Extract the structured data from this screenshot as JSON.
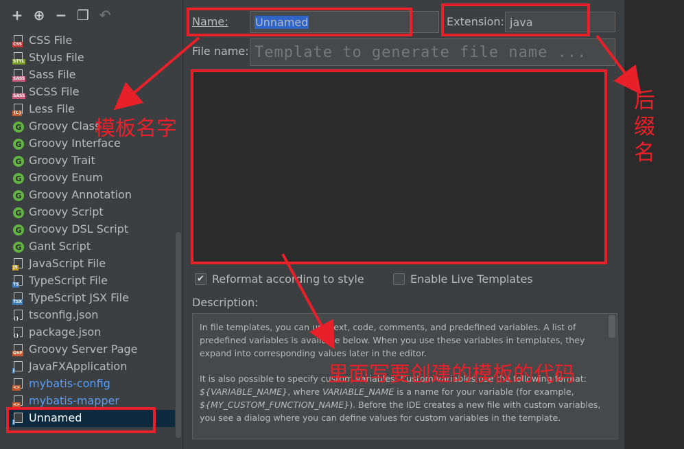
{
  "toolbar": {
    "buttons": [
      {
        "icon": "plus-icon",
        "glyph": "+"
      },
      {
        "icon": "add-child-icon",
        "glyph": "⊕"
      },
      {
        "icon": "minus-icon",
        "glyph": "−"
      },
      {
        "icon": "copy-icon",
        "glyph": "❐"
      },
      {
        "icon": "reset-icon",
        "glyph": "↶"
      }
    ]
  },
  "templates": [
    {
      "label": "CSS File",
      "icon": "css-file-icon",
      "tag": "CSS",
      "tag_color": "#c73b3b"
    },
    {
      "label": "Stylus File",
      "icon": "stylus-file-icon",
      "tag": "STYL",
      "tag_color": "#7b9c2d"
    },
    {
      "label": "Sass File",
      "icon": "sass-file-icon",
      "tag": "SASS",
      "tag_color": "#c75a7a"
    },
    {
      "label": "SCSS File",
      "icon": "scss-file-icon",
      "tag": "SASS",
      "tag_color": "#c75a7a"
    },
    {
      "label": "Less File",
      "icon": "less-file-icon",
      "tag": "{L}",
      "tag_color": "#c2572d"
    },
    {
      "label": "Groovy Class",
      "icon": "groovy-icon"
    },
    {
      "label": "Groovy Interface",
      "icon": "groovy-icon"
    },
    {
      "label": "Groovy Trait",
      "icon": "groovy-icon"
    },
    {
      "label": "Groovy Enum",
      "icon": "groovy-icon"
    },
    {
      "label": "Groovy Annotation",
      "icon": "groovy-icon"
    },
    {
      "label": "Groovy Script",
      "icon": "groovy-icon"
    },
    {
      "label": "Groovy DSL Script",
      "icon": "groovy-icon"
    },
    {
      "label": "Gant Script",
      "icon": "groovy-icon"
    },
    {
      "label": "JavaScript File",
      "icon": "javascript-file-icon",
      "tag": "JS",
      "tag_color": "#c29a2d"
    },
    {
      "label": "TypeScript File",
      "icon": "typescript-file-icon",
      "tag": "TS",
      "tag_color": "#3a78b6"
    },
    {
      "label": "TypeScript JSX File",
      "icon": "tsx-file-icon",
      "tag": "TSX",
      "tag_color": "#3a78b6"
    },
    {
      "label": "tsconfig.json",
      "icon": "json-file-icon",
      "tag": "{}",
      "tag_color": "#3c3f41"
    },
    {
      "label": "package.json",
      "icon": "json-file-icon",
      "tag": "{}",
      "tag_color": "#3c3f41"
    },
    {
      "label": "Groovy Server Page",
      "icon": "gsp-file-icon",
      "tag": "GSP",
      "tag_color": "#c2572d"
    },
    {
      "label": "JavaFXApplication",
      "icon": "java-file-icon",
      "tag": "J",
      "tag_color": "#3a78b6"
    },
    {
      "label": "mybatis-config",
      "icon": "xml-file-icon",
      "tag": "<>",
      "tag_color": "#c2572d",
      "blue": true
    },
    {
      "label": "mybatis-mapper",
      "icon": "xml-file-icon",
      "tag": "<>",
      "tag_color": "#c2572d",
      "blue": true
    },
    {
      "label": "Unnamed",
      "icon": "java-file-icon",
      "tag": "J",
      "tag_color": "#3a78b6",
      "selected": true
    }
  ],
  "form": {
    "name_label": "Name:",
    "name_value": "Unnamed",
    "extension_label": "Extension:",
    "extension_value": "java",
    "filename_label": "File name:",
    "filename_placeholder": "Template to generate file name ...",
    "reformat_label": "Reformat according to style",
    "reformat_checked": true,
    "live_templates_label": "Enable Live Templates",
    "live_templates_checked": false,
    "description_label": "Description:"
  },
  "description": {
    "p1": "In file templates, you can use text, code, comments, and predefined variables. A list of predefined variables is available below. When you use these variables in templates, they expand into corresponding values later in the editor.",
    "p2_a": "It is also possible to specify custom variables. Custom variables use the following format: ",
    "p2_var": "${VARIABLE_NAME}",
    "p2_b": ", where ",
    "p2_var2": "VARIABLE_NAME",
    "p2_c": " is a name for your variable (for example, ",
    "p2_var3": "${MY_CUSTOM_FUNCTION_NAME}",
    "p2_d": "). Before the IDE creates a new file with custom variables, you see a dialog where you can define values for custom variables in the template."
  },
  "annotations": {
    "template_name": "模板名字",
    "extension": "后缀名",
    "code": "里面写要创建的模板的代码",
    "color": "#e8202a"
  }
}
